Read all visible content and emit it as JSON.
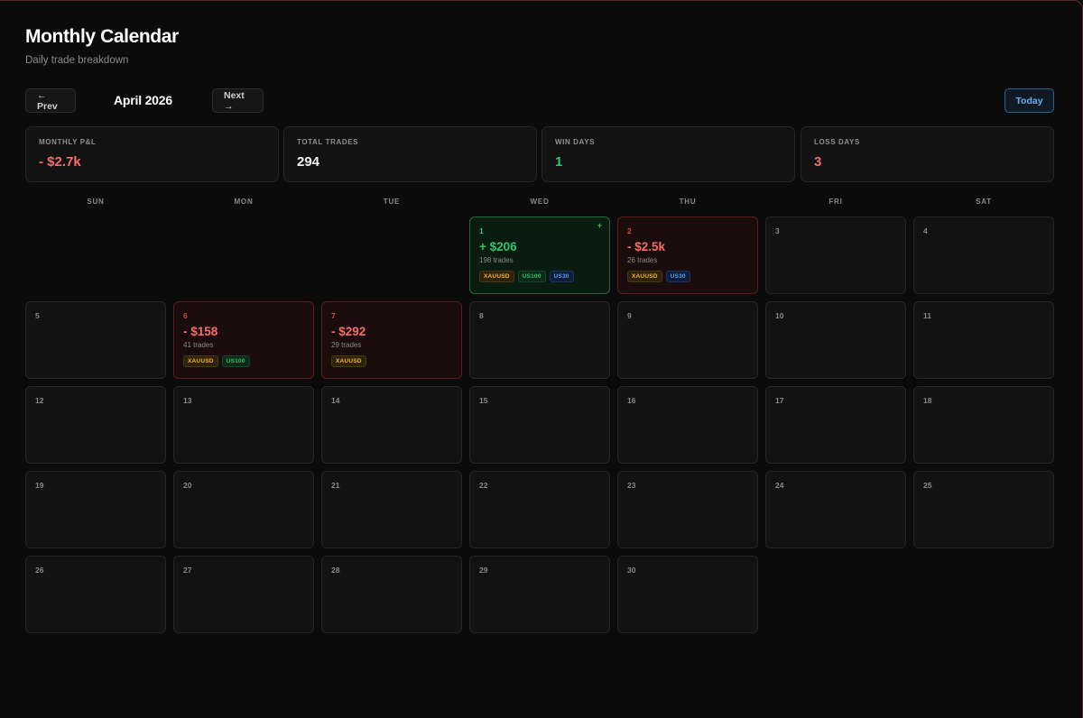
{
  "header": {
    "title": "Monthly Calendar",
    "subtitle": "Daily trade breakdown"
  },
  "nav": {
    "prev_label": "← Prev",
    "month_label": "April 2026",
    "next_label": "Next →",
    "today_label": "Today"
  },
  "stats": [
    {
      "label": "MONTHLY P&L",
      "value": "- $2.7k",
      "tone": "red"
    },
    {
      "label": "TOTAL TRADES",
      "value": "294",
      "tone": "white"
    },
    {
      "label": "WIN DAYS",
      "value": "1",
      "tone": "green"
    },
    {
      "label": "LOSS DAYS",
      "value": "3",
      "tone": "red"
    }
  ],
  "weekdays": [
    "SUN",
    "MON",
    "TUE",
    "WED",
    "THU",
    "FRI",
    "SAT"
  ],
  "calendar": {
    "first_weekday_index": 3,
    "days_in_month": 30,
    "trade_days": {
      "1": {
        "pnl": "+ $206",
        "trades": "198 trades",
        "result": "win",
        "marker": "+",
        "tags": [
          "XAUUSD",
          "US100",
          "US30"
        ]
      },
      "2": {
        "pnl": "- $2.5k",
        "trades": "26 trades",
        "result": "loss",
        "tags": [
          "XAUUSD",
          "US30"
        ]
      },
      "6": {
        "pnl": "- $158",
        "trades": "41 trades",
        "result": "loss",
        "tags": [
          "XAUUSD",
          "US100"
        ]
      },
      "7": {
        "pnl": "- $292",
        "trades": "29 trades",
        "result": "loss",
        "tags": [
          "XAUUSD"
        ]
      }
    }
  },
  "colors": {
    "win": "#34c26a",
    "loss": "#f56c6c",
    "accent": "#6eaff0",
    "tag_xauusd": "#f0b43c",
    "tag_us100": "#34c26a",
    "tag_us30": "#5e9cf0"
  }
}
